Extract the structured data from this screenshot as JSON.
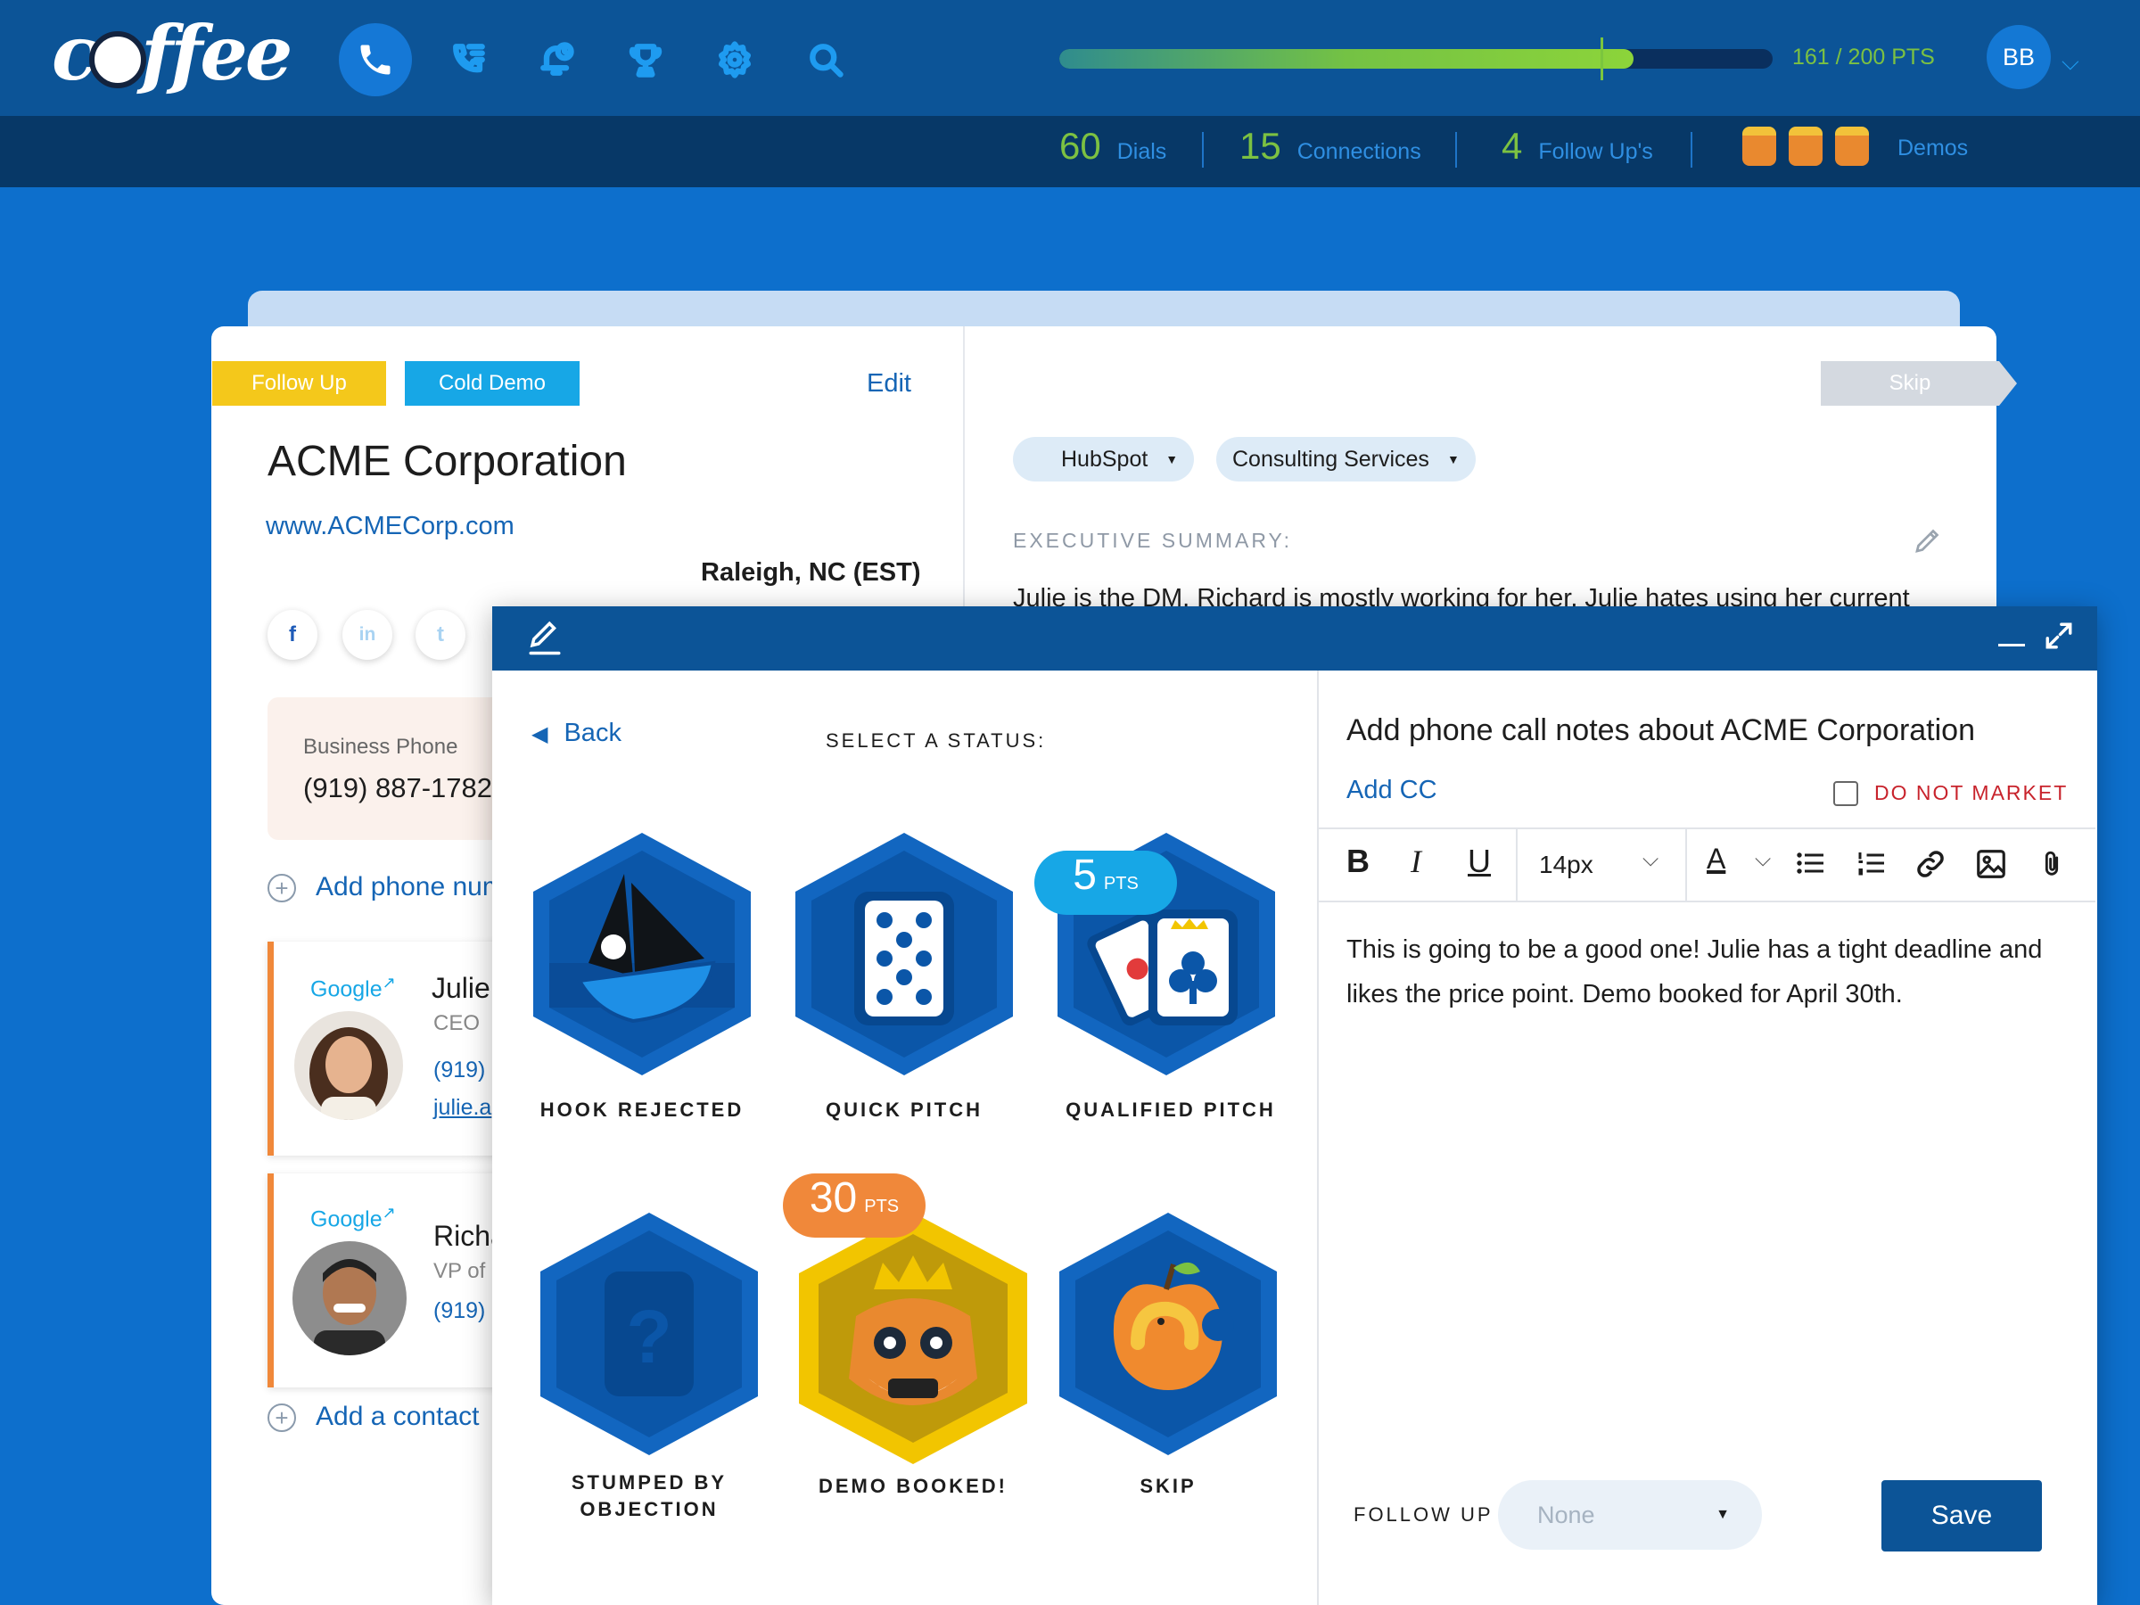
{
  "brand": {
    "logo_text": "coffee"
  },
  "nav": {
    "icons": [
      "phone-icon",
      "call-list-icon",
      "alarm-bell-icon",
      "trophy-icon",
      "gear-icon",
      "search-icon"
    ],
    "progress": {
      "value": 161,
      "max": 200,
      "fraction": 0.805,
      "label": "161 / 200 PTS"
    },
    "user_initials": "BB"
  },
  "stats": {
    "dials": {
      "value": "60",
      "label": "Dials"
    },
    "connections": {
      "value": "15",
      "label": "Connections"
    },
    "followups": {
      "value": "4",
      "label": "Follow Up's"
    },
    "demos": {
      "count": 3,
      "label": "Demos"
    }
  },
  "company": {
    "tags": [
      "Follow Up",
      "Cold Demo"
    ],
    "edit": "Edit",
    "name": "ACME Corporation",
    "url": "www.ACMECorp.com",
    "location": "Raleigh, NC (EST)",
    "social": [
      "f",
      "in",
      "t"
    ],
    "phone_label": "Business Phone",
    "phone_value": "(919) 887-1782",
    "add_phone": "Add phone num",
    "contacts": [
      {
        "source": "Google",
        "name": "Julie",
        "role": "CEO",
        "phone": "(919) 8",
        "email": "julie.a"
      },
      {
        "source": "Google",
        "name": "Richa",
        "role": "VP of",
        "phone": "(919) 8"
      }
    ],
    "add_contact": "Add a contact"
  },
  "summary": {
    "skip": "Skip",
    "pills": [
      "HubSpot",
      "Consulting Services"
    ],
    "label": "EXECUTIVE SUMMARY:",
    "text": "Julie is the DM. Richard is mostly working for her. Julie hates using her current"
  },
  "modal": {
    "back": "Back",
    "select_label": "SELECT A STATUS:",
    "statuses": [
      {
        "label": "HOOK REJECTED"
      },
      {
        "label": "QUICK PITCH"
      },
      {
        "label": "QUALIFIED PITCH",
        "pts": "5",
        "pts_unit": "PTS"
      },
      {
        "label_line1": "STUMPED BY",
        "label_line2": "OBJECTION"
      },
      {
        "label": "DEMO BOOKED!",
        "pts": "30",
        "pts_unit": "PTS"
      },
      {
        "label": "SKIP"
      }
    ],
    "notes_title": "Add phone call notes about ACME Corporation",
    "add_cc": "Add CC",
    "do_not_market": "DO NOT MARKET",
    "toolbar": {
      "bold": "B",
      "italic": "I",
      "underline": "U",
      "font_size": "14px",
      "text_color": "A"
    },
    "notes_body": "This is going to be a good one! Julie has a tight deadline and likes the price point. Demo booked for April 30th.",
    "follow_up_label": "FOLLOW UP",
    "follow_up_value": "None",
    "save": "Save"
  },
  "colors": {
    "nav": "#0C5497",
    "background": "#0D6FCC",
    "accent_green": "#7CC142",
    "link_blue": "#1565B5",
    "tag_yellow": "#F4C81B",
    "tag_cyan": "#17A7E6",
    "orange": "#F0883A",
    "gold": "#F2C500"
  }
}
